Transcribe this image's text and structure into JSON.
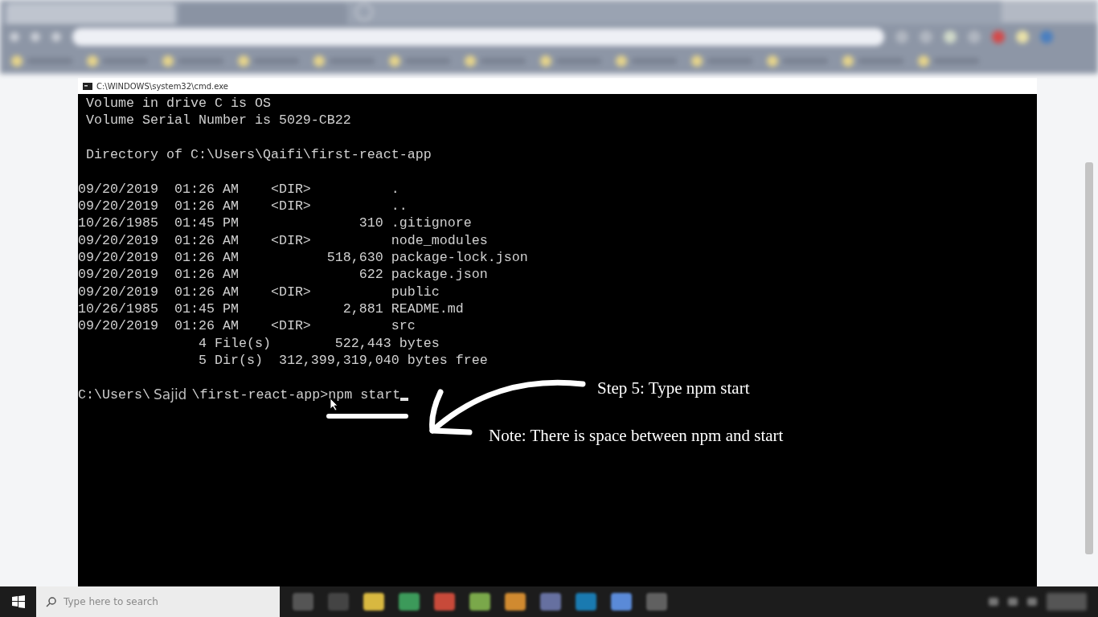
{
  "browser": {
    "tabs": [
      {
        "selected": true
      },
      {
        "selected": false
      }
    ]
  },
  "terminal": {
    "title": "C:\\WINDOWS\\system32\\cmd.exe",
    "blocks": [
      [
        " Volume in drive C is OS",
        " Volume Serial Number is 5029-CB22"
      ],
      [
        " Directory of C:\\Users\\Qaifi\\first-react-app"
      ],
      [
        "09/20/2019  01:26 AM    <DIR>          .",
        "09/20/2019  01:26 AM    <DIR>          ..",
        "10/26/1985  01:45 PM               310 .gitignore",
        "09/20/2019  01:26 AM    <DIR>          node_modules",
        "09/20/2019  01:26 AM           518,630 package-lock.json",
        "09/20/2019  01:26 AM               622 package.json",
        "09/20/2019  01:26 AM    <DIR>          public",
        "10/26/1985  01:45 PM             2,881 README.md",
        "09/20/2019  01:26 AM    <DIR>          src",
        "               4 File(s)        522,443 bytes",
        "               5 Dir(s)  312,399,319,040 bytes free"
      ]
    ],
    "prompt": [
      {
        "text": "C:\\Users\\",
        "kind": "mono"
      },
      {
        "text": "Sajid",
        "kind": "sans"
      },
      {
        "text": "\\first-react-app>npm start",
        "kind": "mono"
      }
    ]
  },
  "annotations": [
    {
      "text": "Step 5: Type npm start"
    },
    {
      "text": "Note: There is space between npm and start"
    }
  ],
  "taskbar": {
    "search": {
      "placeholder": "Type here to search"
    }
  }
}
